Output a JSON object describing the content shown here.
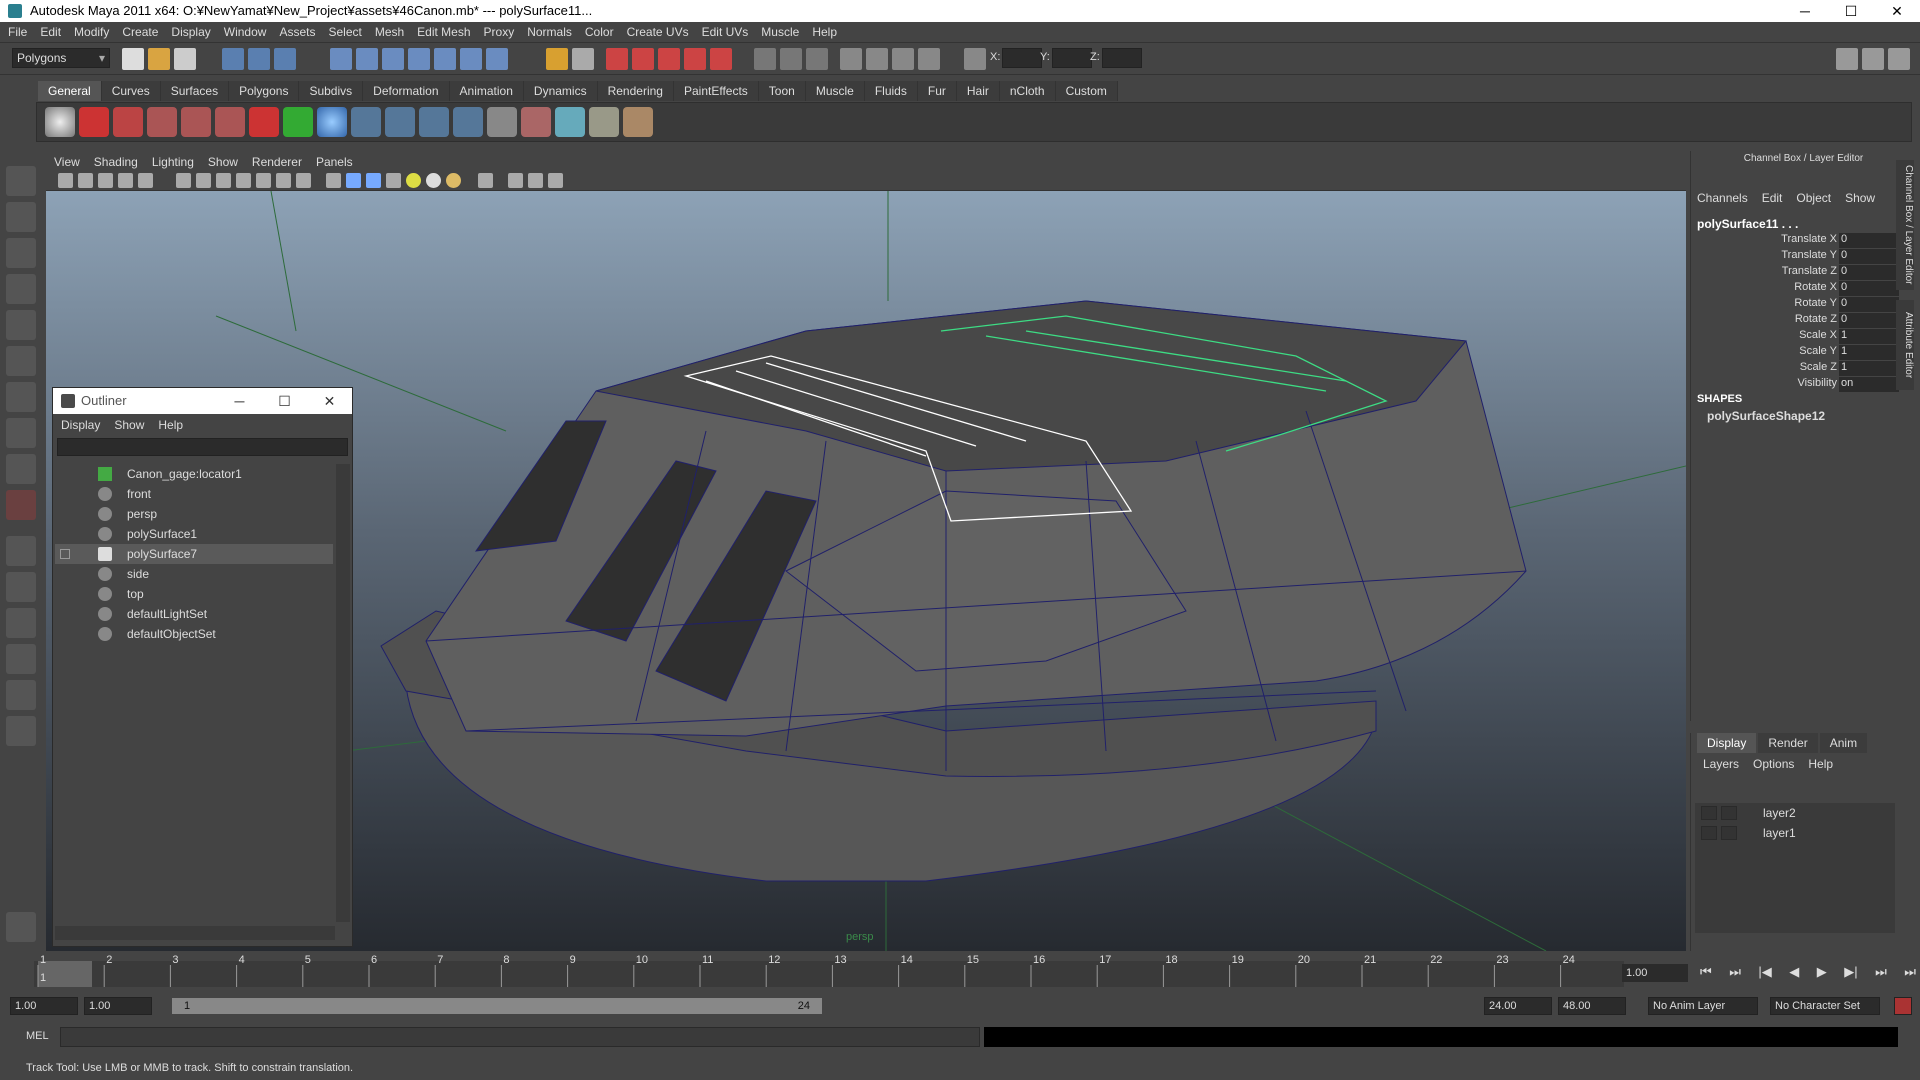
{
  "window": {
    "title": "Autodesk Maya 2011 x64: O:¥NewYamat¥New_Project¥assets¥46Canon.mb*   ---   polySurface11...",
    "minimize": "─",
    "maximize": "☐",
    "close": "✕"
  },
  "menubar": [
    "File",
    "Edit",
    "Modify",
    "Create",
    "Display",
    "Window",
    "Assets",
    "Select",
    "Mesh",
    "Edit Mesh",
    "Proxy",
    "Normals",
    "Color",
    "Create UVs",
    "Edit UVs",
    "Muscle",
    "Help"
  ],
  "status": {
    "mode": "Polygons",
    "x_label": "X:",
    "y_label": "Y:",
    "z_label": "Z:"
  },
  "shelf": {
    "tabs": [
      "General",
      "Curves",
      "Surfaces",
      "Polygons",
      "Subdivs",
      "Deformation",
      "Animation",
      "Dynamics",
      "Rendering",
      "PaintEffects",
      "Toon",
      "Muscle",
      "Fluids",
      "Fur",
      "Hair",
      "nCloth",
      "Custom"
    ],
    "active": "General"
  },
  "viewport": {
    "menu": [
      "View",
      "Shading",
      "Lighting",
      "Show",
      "Renderer",
      "Panels"
    ],
    "camera_label": "persp"
  },
  "outliner": {
    "title": "Outliner",
    "menu": [
      "Display",
      "Show",
      "Help"
    ],
    "items": [
      {
        "label": "Canon_gage:locator1",
        "icon": "locator-icon",
        "expand": false
      },
      {
        "label": "front",
        "icon": "camera-icon"
      },
      {
        "label": "persp",
        "icon": "camera-icon"
      },
      {
        "label": "polySurface1",
        "icon": "mesh-icon"
      },
      {
        "label": "polySurface7",
        "icon": "mesh-icon",
        "selected": true,
        "expand": true
      },
      {
        "label": "side",
        "icon": "camera-icon"
      },
      {
        "label": "top",
        "icon": "camera-icon"
      },
      {
        "label": "defaultLightSet",
        "icon": "set-icon"
      },
      {
        "label": "defaultObjectSet",
        "icon": "set-icon"
      }
    ]
  },
  "channelbox": {
    "title": "Channel Box / Layer Editor",
    "menu": [
      "Channels",
      "Edit",
      "Object",
      "Show"
    ],
    "object": "polySurface11 . . .",
    "attrs": [
      {
        "name": "Translate X",
        "value": "0"
      },
      {
        "name": "Translate Y",
        "value": "0"
      },
      {
        "name": "Translate Z",
        "value": "0"
      },
      {
        "name": "Rotate X",
        "value": "0"
      },
      {
        "name": "Rotate Y",
        "value": "0"
      },
      {
        "name": "Rotate Z",
        "value": "0"
      },
      {
        "name": "Scale X",
        "value": "1"
      },
      {
        "name": "Scale Y",
        "value": "1"
      },
      {
        "name": "Scale Z",
        "value": "1"
      },
      {
        "name": "Visibility",
        "value": "on"
      }
    ],
    "shapes_header": "SHAPES",
    "shape": "polySurfaceShape12",
    "side_tabs": [
      "Channel Box / Layer Editor",
      "Attribute Editor"
    ]
  },
  "layers": {
    "tabs": [
      "Display",
      "Render",
      "Anim"
    ],
    "active": "Display",
    "menu": [
      "Layers",
      "Options",
      "Help"
    ],
    "items": [
      "layer2",
      "layer1"
    ]
  },
  "timeline": {
    "ticks": [
      "1",
      "2",
      "3",
      "4",
      "5",
      "6",
      "7",
      "8",
      "9",
      "10",
      "11",
      "12",
      "13",
      "14",
      "15",
      "16",
      "17",
      "18",
      "19",
      "20",
      "21",
      "22",
      "23",
      "24"
    ],
    "current_frame_label": "1",
    "current": "1.00",
    "playback": [
      "⏮",
      "⏭",
      "|◀",
      "◀",
      "▶",
      "▶|",
      "⏭",
      "⏭"
    ]
  },
  "range": {
    "start": "1.00",
    "start2": "1.00",
    "range_start": "1",
    "range_end": "24",
    "end": "24.00",
    "end2": "48.00",
    "anim_layer": "No Anim Layer",
    "char_set": "No Character Set"
  },
  "cmd": {
    "label": "MEL"
  },
  "help": "Track Tool: Use LMB or MMB to track. Shift to constrain translation.",
  "colors": {
    "accent_green": "#3ddc84",
    "mesh_face": "#5f5f5f",
    "wire_blue": "#1a1a7a",
    "selected_white": "#ffffff"
  }
}
